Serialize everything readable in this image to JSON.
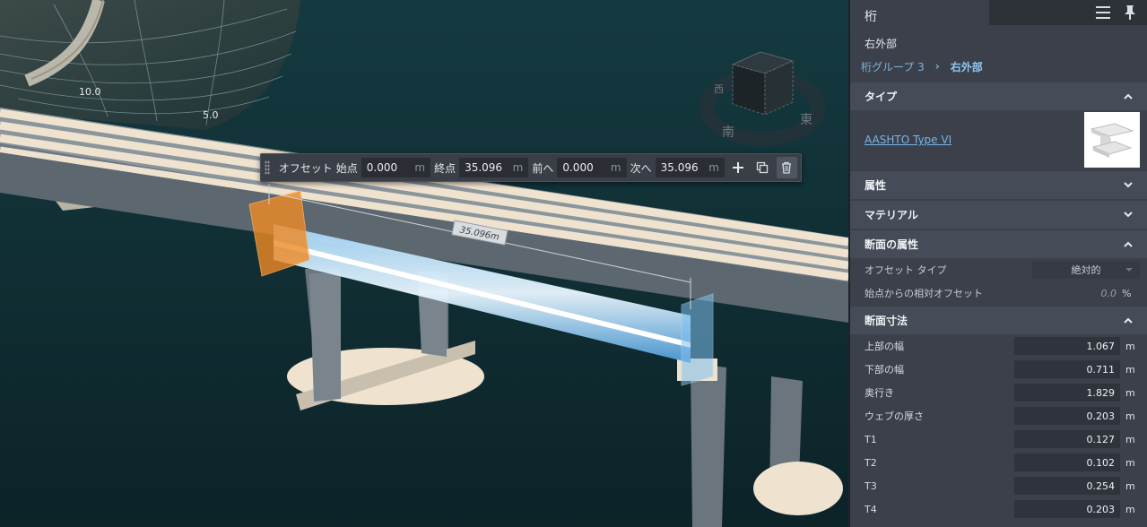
{
  "toolbar": {
    "offset_label": "オフセット",
    "start_label": "始点",
    "start_value": "0.000",
    "end_label": "終点",
    "end_value": "35.096",
    "prev_label": "前へ",
    "prev_value": "0.000",
    "next_label": "次へ",
    "next_value": "35.096",
    "unit": "m",
    "add_icon": "plus-icon",
    "copy_icon": "copy-icon",
    "delete_icon": "trash-icon"
  },
  "viewport": {
    "contour_labels": [
      "10.0",
      "5.0"
    ],
    "dimension_label": "35.096m",
    "compass": {
      "west": "西",
      "south": "南",
      "east": "東"
    },
    "colors": {
      "water": "#0f2a30",
      "selection_blue": "#5aaee8",
      "selection_orange": "#f08a24"
    }
  },
  "panel": {
    "title": "桁",
    "menu_icon": "hamburger-icon",
    "pin_icon": "pin-icon",
    "subtitle": "右外部",
    "breadcrumb": {
      "parent": "桁グループ 3",
      "current": "右外部"
    },
    "sections": {
      "type": {
        "title": "タイプ",
        "link": "AASHTO Type VI",
        "expanded": true
      },
      "attributes": {
        "title": "属性",
        "expanded": false
      },
      "material": {
        "title": "マテリアル",
        "expanded": false
      },
      "section_props": {
        "title": "断面の属性",
        "expanded": true,
        "offset_type_label": "オフセット タイプ",
        "offset_type_value": "絶対的",
        "relative_offset_label": "始点からの相対オフセット",
        "relative_offset_value": "0.0",
        "relative_offset_unit": "%"
      },
      "dimensions": {
        "title": "断面寸法",
        "expanded": true,
        "rows": [
          {
            "label": "上部の幅",
            "value": "1.067",
            "unit": "m"
          },
          {
            "label": "下部の幅",
            "value": "0.711",
            "unit": "m"
          },
          {
            "label": "奥行き",
            "value": "1.829",
            "unit": "m"
          },
          {
            "label": "ウェブの厚さ",
            "value": "0.203",
            "unit": "m"
          },
          {
            "label": "T1",
            "value": "0.127",
            "unit": "m"
          },
          {
            "label": "T2",
            "value": "0.102",
            "unit": "m"
          },
          {
            "label": "T3",
            "value": "0.254",
            "unit": "m"
          },
          {
            "label": "T4",
            "value": "0.203",
            "unit": "m"
          }
        ]
      }
    }
  }
}
